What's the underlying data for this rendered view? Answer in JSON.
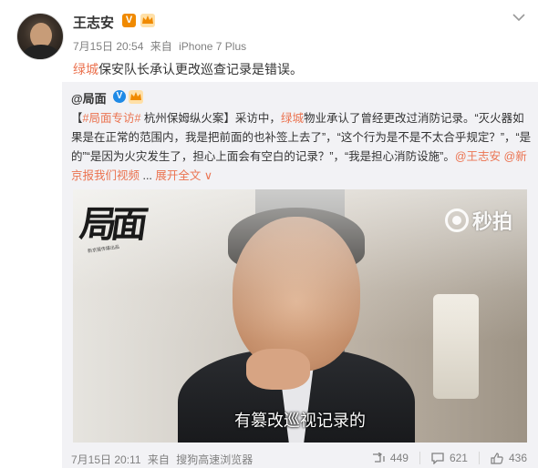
{
  "post": {
    "username": "王志安",
    "verified_badge": "V",
    "date": "7月15日 20:54",
    "source_prefix": "来自",
    "source": "iPhone 7 Plus",
    "text_tag": "绿城",
    "text_rest": "保安队长承认更改巡查记录是错误。"
  },
  "repost": {
    "author": "@局面",
    "text": {
      "bracket_open": "【",
      "topic1": "#局面专访#",
      "topic2": " 杭州保姆纵火案",
      "bracket_close": "】",
      "part1": "采访中，",
      "red_word": "绿城",
      "part2": "物业承认了曾经更改过消防记录。“灭火器如果是在正常的范围内，我是把前面的也补签上去了”，“这个行为是不是不太合乎规定？”，“是的”“是因为火灾发生了，担心上面会有空白的记录？”，“我是担心消防设施”。",
      "mention1": "@王志安",
      "mention2": "@新京报我们视频",
      "expand_dots": " ... ",
      "expand_label": "展开全文",
      "expand_arrow": "∨"
    },
    "video": {
      "logo_text": "局面",
      "logo_sub": "新京报传媒出品",
      "watermark": "秒拍",
      "subtitle": "有篡改巡视记录的"
    },
    "footer": {
      "date": "7月15日 20:11",
      "source_prefix": "来自",
      "source": "搜狗高速浏览器"
    },
    "stats": {
      "reposts": "449",
      "comments": "621",
      "likes": "436"
    }
  },
  "colors": {
    "link": "#eb7350",
    "meta_gray": "#808080",
    "repost_bg": "#f2f2f5",
    "verified_orange": "#f08a00",
    "verified_blue": "#1f8ae6"
  },
  "icons": [
    "chevron-down-icon",
    "crown-icon",
    "repost-icon",
    "comment-icon",
    "like-icon",
    "miaopai-eye-icon"
  ]
}
